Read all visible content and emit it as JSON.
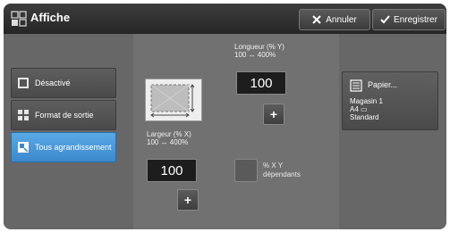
{
  "header": {
    "title": "Affiche",
    "title_icon": "poster-icon",
    "cancel_label": "Annuler",
    "save_label": "Enregistrer"
  },
  "sidebar": {
    "items": [
      {
        "label": "Désactivé",
        "icon": "off-icon",
        "selected": false
      },
      {
        "label": "Format de sortie",
        "icon": "output-format-icon",
        "selected": false
      },
      {
        "label": "Tous agrandissement",
        "icon": "enlarge-icon",
        "selected": true
      }
    ]
  },
  "length": {
    "label": "Longueur (% Y)",
    "range": "100 ↔ 400%",
    "value": "100",
    "increment": "+"
  },
  "width": {
    "label": "Largeur (% X)",
    "range": "100 ↔ 400%",
    "value": "100",
    "increment": "+"
  },
  "linked": {
    "label_line1": "% X Y",
    "label_line2": "dépendants",
    "checked": false
  },
  "paper": {
    "title": "Papier...",
    "tray": "Magasin 1",
    "size": "A4 ▭",
    "type": "Standard",
    "icon": "paper-icon"
  },
  "colors": {
    "accent": "#4a9be0",
    "header": "#2f2f2f",
    "panel": "#6a6a6a"
  }
}
